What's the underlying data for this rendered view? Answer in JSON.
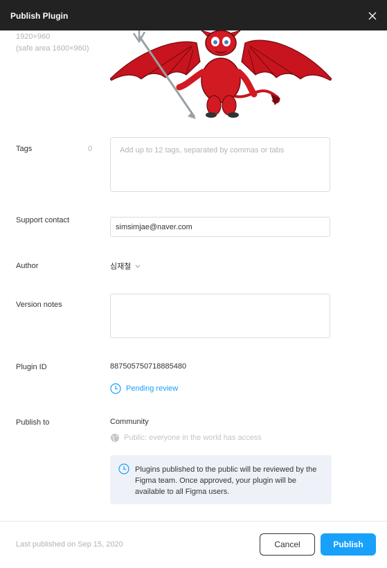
{
  "window": {
    "title": "Publish Plugin"
  },
  "cover": {
    "size": "1920×960",
    "safe_area": "(safe area 1600×960)"
  },
  "tags": {
    "label": "Tags",
    "count": "0",
    "placeholder": "Add up to 12 tags, separated by commas or tabs"
  },
  "support": {
    "label": "Support contact",
    "value": "simsimjae@naver.com"
  },
  "author": {
    "label": "Author",
    "value": "심재철"
  },
  "version_notes": {
    "label": "Version notes"
  },
  "plugin_id": {
    "label": "Plugin ID",
    "value": "887505750718885480",
    "status": "Pending review"
  },
  "publish_to": {
    "label": "Publish to",
    "value": "Community",
    "visibility": "Public: everyone in the world has access",
    "info": "Plugins published to the public will be reviewed by the Figma team. Once approved, your plugin will be available to all Figma users."
  },
  "footer": {
    "last_published": "Last published on Sep 15, 2020",
    "cancel": "Cancel",
    "publish": "Publish"
  },
  "colors": {
    "accent": "#18a0fb",
    "titlebar": "#222222",
    "info_bg": "#eef2f8",
    "devil_red": "#c8141e"
  }
}
